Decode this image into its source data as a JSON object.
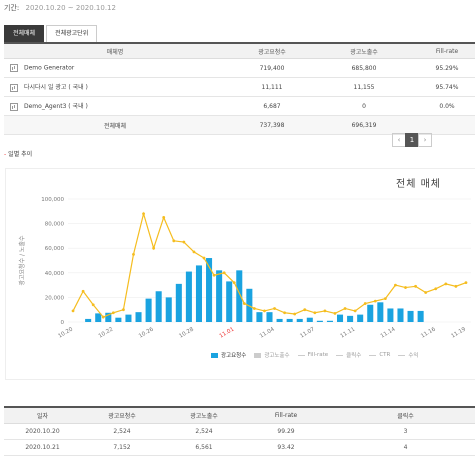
{
  "period": {
    "label": "기간:",
    "value": "2020.10.20 ~ 2020.10.12"
  },
  "tabs": [
    {
      "label": "전체매체"
    },
    {
      "label": "전체광고단위"
    }
  ],
  "table1": {
    "headers": [
      "매체명",
      "광고요청수",
      "광고노출수",
      "Fill-rate"
    ],
    "rows": [
      {
        "name": "Demo Generator",
        "requests": "719,400",
        "impressions": "685,800",
        "fill": "95.29%"
      },
      {
        "name": "다시다시 일 광고 ( 국내 )",
        "requests": "11,111",
        "impressions": "11,155",
        "fill": "95.74%"
      },
      {
        "name": "Demo_Agent3 ( 국내 )",
        "requests": "6,687",
        "impressions": "0",
        "fill": "0.0%"
      }
    ],
    "total": {
      "label": "전체매체",
      "requests": "737,398",
      "impressions": "696,319"
    }
  },
  "pager": {
    "prev": "‹",
    "current": "1",
    "next": "›"
  },
  "section_title": "일별 추이",
  "chart_data": {
    "type": "bar",
    "title": "전체 매체",
    "ylabel": "광고요청수 / 노출수",
    "ylim": [
      0,
      100000
    ],
    "yticks": [
      "0",
      "20,000",
      "40,000",
      "60,000",
      "80,000",
      "100,000"
    ],
    "x_tick_labels": [
      {
        "i": 0,
        "label": "10.20",
        "red": false
      },
      {
        "i": 4,
        "label": "10.22",
        "red": false
      },
      {
        "i": 8,
        "label": "10.26",
        "red": false
      },
      {
        "i": 12,
        "label": "10.28",
        "red": false
      },
      {
        "i": 16,
        "label": "11.01",
        "red": true
      },
      {
        "i": 20,
        "label": "11.04",
        "red": false
      },
      {
        "i": 24,
        "label": "11.07",
        "red": false
      },
      {
        "i": 28,
        "label": "11.11",
        "red": false
      },
      {
        "i": 32,
        "label": "11.14",
        "red": false
      },
      {
        "i": 36,
        "label": "11.16",
        "red": false
      },
      {
        "i": 39,
        "label": "11.19",
        "red": false
      }
    ],
    "series": [
      {
        "name": "광고요청수",
        "type": "bar",
        "values": [
          2500,
          7000,
          7500,
          3500,
          6000,
          8000,
          19000,
          25000,
          20000,
          31000,
          41000,
          46000,
          52000,
          42000,
          33000,
          42000,
          27000,
          8000,
          8000,
          2500,
          2500,
          2500,
          3500,
          1000,
          1000,
          6000,
          5000,
          6000,
          14000,
          16000,
          11000,
          11000,
          9000,
          9000
        ]
      },
      {
        "name": "광고노출수",
        "type": "line",
        "values": [
          9000,
          25000,
          14000,
          4000,
          7500,
          10000,
          55000,
          88000,
          60000,
          85000,
          66000,
          65000,
          57000,
          52000,
          38000,
          40000,
          32000,
          15000,
          11000,
          9000,
          11000,
          7500,
          6500,
          10000,
          7500,
          9000,
          7000,
          11000,
          9000,
          15000,
          17000,
          19000,
          30000,
          28000,
          29000,
          24000,
          27000,
          31000,
          29000,
          32000
        ]
      }
    ],
    "legend": [
      "광고요청수",
      "광고노출수",
      "Fill-rate",
      "클릭수",
      "CTR",
      "수익"
    ]
  },
  "colors": {
    "bar": "#1aa3e0",
    "line": "#f5bd1f",
    "tab_active": "#3a3a3a",
    "pager_current": "#555555"
  },
  "table2": {
    "headers": [
      "일자",
      "광고요청수",
      "광고노출수",
      "Fill-rate",
      "클릭수"
    ],
    "rows": [
      {
        "date": "2020.10.20",
        "requests": "2,524",
        "impressions": "2,524",
        "fill": "99.29",
        "clicks": "3"
      },
      {
        "date": "2020.10.21",
        "requests": "7,152",
        "impressions": "6,561",
        "fill": "93.42",
        "clicks": "4"
      }
    ]
  }
}
